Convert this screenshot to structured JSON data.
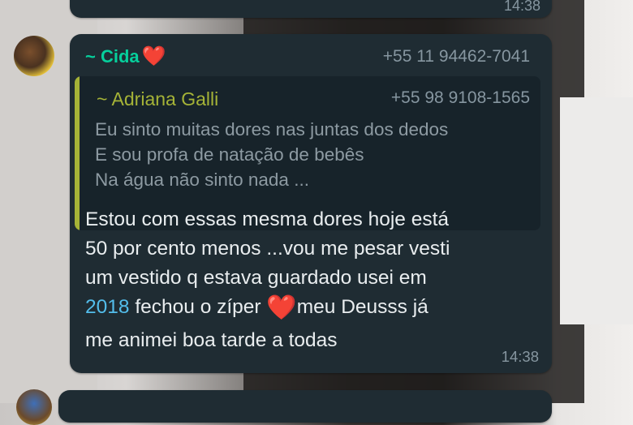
{
  "previous_message": {
    "time": "14:38"
  },
  "message": {
    "sender_name": "~ Cida",
    "sender_emoji": "❤️",
    "sender_phone": "+55 11 94462-7041",
    "quoted": {
      "name": "~ Adriana Galli",
      "phone": "+55 98 9108-1565",
      "lines": [
        "Eu sinto muitas dores nas juntas dos dedos",
        "E sou profa de natação de bebês",
        "Na água não sinto nada ..."
      ]
    },
    "text_lines": [
      "Estou com essas mesma dores hoje está",
      "50 por cento menos ...vou me pesar vesti",
      "um vestido q estava guardado usei em"
    ],
    "line4_link": "2018",
    "line4_mid": " fechou o zíper ",
    "line4_emoji": "❤️",
    "line4_end": "meu Deusss já",
    "text_last": "me animei boa tarde a todas",
    "time": "14:38"
  },
  "colors": {
    "bubble": "#1f2c33",
    "sender": "#06cf9c",
    "quote_accent": "#a5b337",
    "link": "#53bdeb",
    "heart": "#e0322e"
  },
  "icons": [
    "heart-emoji",
    "avatar-image"
  ]
}
